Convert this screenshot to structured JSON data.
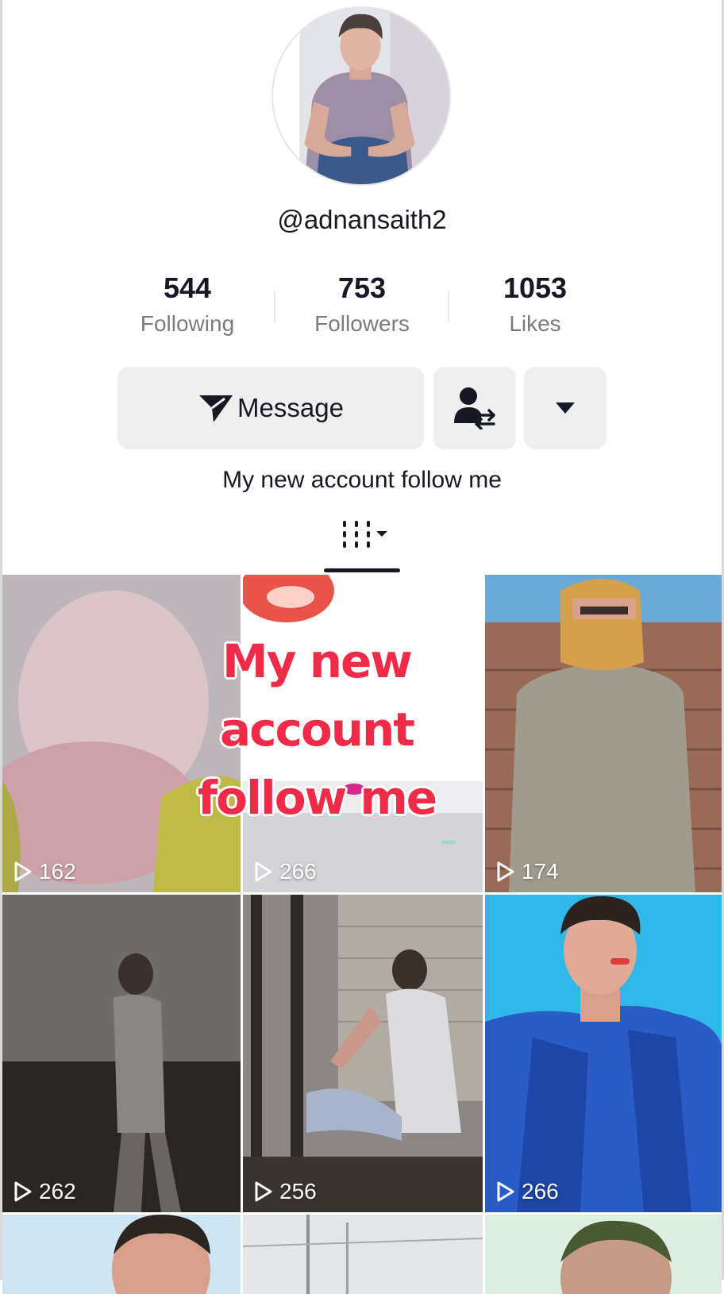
{
  "profile": {
    "username": "@adnansaith2",
    "bio": "My new account follow me"
  },
  "stats": [
    {
      "value": "544",
      "label": "Following"
    },
    {
      "value": "753",
      "label": "Followers"
    },
    {
      "value": "1053",
      "label": "Likes"
    }
  ],
  "actions": {
    "message_label": "Message",
    "add_friend_icon": "person-swap-icon",
    "more_icon": "caret-down-icon"
  },
  "tabs": {
    "active_icon": "grid-icon"
  },
  "videos": [
    {
      "views": "162"
    },
    {
      "views": "266"
    },
    {
      "views": "174"
    },
    {
      "views": "262"
    },
    {
      "views": "256"
    },
    {
      "views": "266"
    }
  ],
  "overlay_text": {
    "line1": "My new account",
    "line2": "follow me"
  },
  "colors": {
    "overlay_red": "#ef2b48",
    "text": "#161823",
    "muted": "#7a7b80",
    "button_bg": "#efefef"
  }
}
